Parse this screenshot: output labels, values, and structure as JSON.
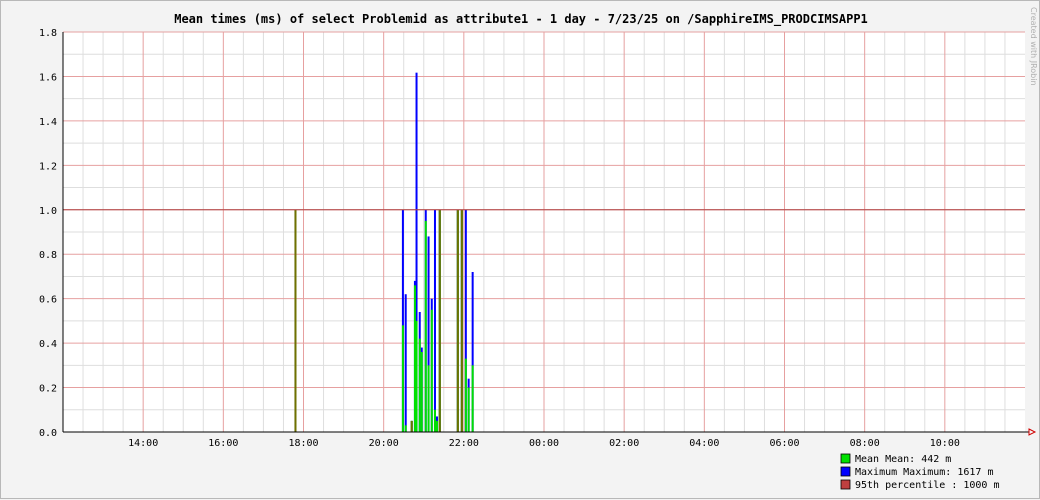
{
  "chart_data": {
    "type": "bar",
    "title": "Mean times (ms) of select Problemid as attribute1 - 1 day - 7/23/25 on /SapphireIMS_PRODCIMSAPP1",
    "watermark": "Created with JRobin",
    "ylim": [
      0,
      1.8
    ],
    "xlim_hours": [
      12.0,
      36.0
    ],
    "yticks": [
      "0.0",
      "0.2",
      "0.4",
      "0.6",
      "0.8",
      "1.0",
      "1.2",
      "1.4",
      "1.6",
      "1.8"
    ],
    "xticks": [
      {
        "h": 14,
        "label": "14:00"
      },
      {
        "h": 16,
        "label": "16:00"
      },
      {
        "h": 18,
        "label": "18:00"
      },
      {
        "h": 20,
        "label": "20:00"
      },
      {
        "h": 22,
        "label": "22:00"
      },
      {
        "h": 24,
        "label": "00:00"
      },
      {
        "h": 26,
        "label": "02:00"
      },
      {
        "h": 28,
        "label": "04:00"
      },
      {
        "h": 30,
        "label": "06:00"
      },
      {
        "h": 32,
        "label": "08:00"
      },
      {
        "h": 34,
        "label": "10:00"
      }
    ],
    "threshold": 1.0,
    "colors": {
      "mean": "#00e000",
      "max": "#0000ff",
      "p95": "#c04040",
      "overlap": "#707000"
    },
    "series": [
      {
        "key": "max",
        "name": "Maximum",
        "values": [
          [
            17.8,
            1.0
          ],
          [
            20.48,
            1.0
          ],
          [
            20.55,
            0.62
          ],
          [
            20.7,
            0.05
          ],
          [
            20.78,
            0.68
          ],
          [
            20.82,
            1.617
          ],
          [
            20.9,
            0.54
          ],
          [
            20.95,
            0.38
          ],
          [
            21.05,
            1.0
          ],
          [
            21.12,
            0.88
          ],
          [
            21.2,
            0.6
          ],
          [
            21.28,
            1.0
          ],
          [
            21.33,
            0.07
          ],
          [
            21.4,
            1.0
          ],
          [
            21.85,
            1.0
          ],
          [
            21.95,
            1.0
          ],
          [
            22.05,
            1.0
          ],
          [
            22.12,
            0.24
          ],
          [
            22.22,
            0.72
          ]
        ]
      },
      {
        "key": "mean",
        "name": "Mean",
        "values": [
          [
            17.8,
            1.0
          ],
          [
            20.48,
            0.48
          ],
          [
            20.55,
            0.03
          ],
          [
            20.7,
            0.05
          ],
          [
            20.78,
            0.66
          ],
          [
            20.82,
            0.5
          ],
          [
            20.9,
            0.42
          ],
          [
            20.95,
            0.36
          ],
          [
            21.05,
            0.95
          ],
          [
            21.12,
            0.3
          ],
          [
            21.2,
            0.55
          ],
          [
            21.28,
            0.1
          ],
          [
            21.33,
            0.05
          ],
          [
            21.4,
            1.0
          ],
          [
            21.85,
            1.0
          ],
          [
            21.95,
            1.0
          ],
          [
            22.05,
            0.33
          ],
          [
            22.12,
            0.2
          ],
          [
            22.22,
            0.3
          ]
        ]
      }
    ],
    "legend": [
      {
        "color": "#00e000",
        "text": "Mean  Mean:      442 m"
      },
      {
        "color": "#0000ff",
        "text": "Maximum  Maximum:    1617 m"
      },
      {
        "color": "#c04040",
        "text": "95th percentile  :    1000 m"
      }
    ]
  }
}
